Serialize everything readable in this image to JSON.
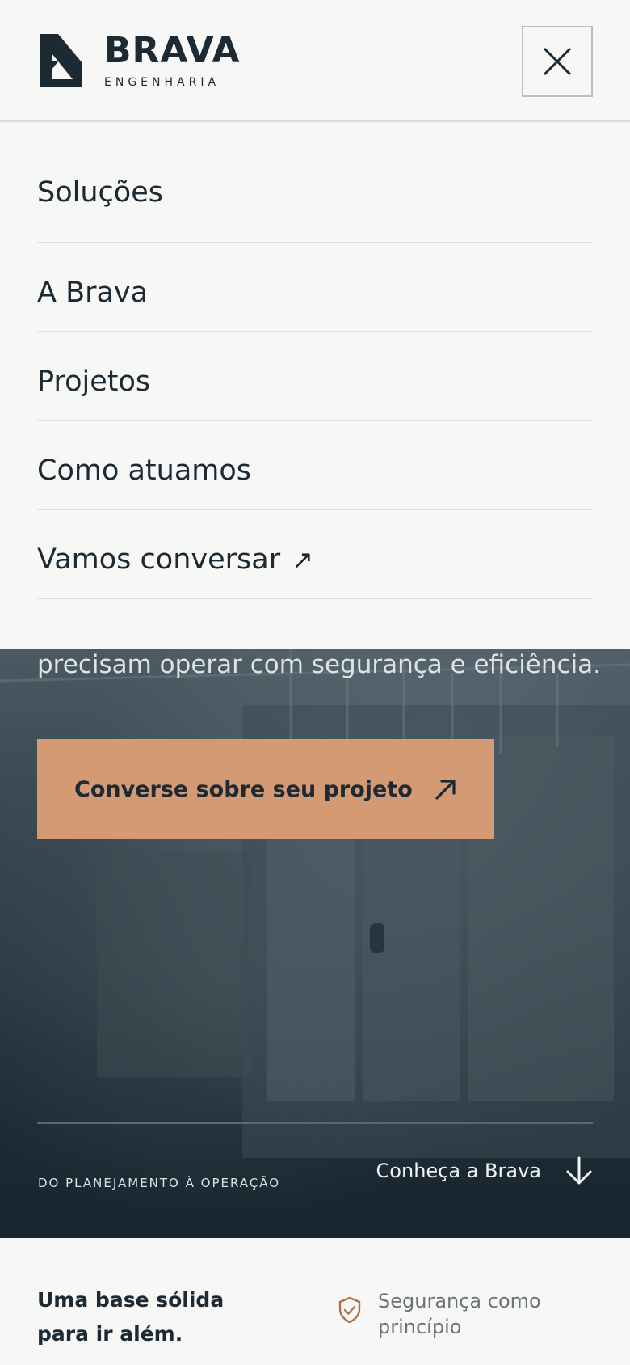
{
  "brand": {
    "name": "BRAVA",
    "tagline": "ENGENHARIA",
    "colors": {
      "ink": "#1c2a33",
      "accent": "#d39a73",
      "background": "#f7f7f5"
    }
  },
  "header": {
    "close_icon": "close-icon"
  },
  "menu": {
    "items": [
      {
        "label": "Soluções"
      },
      {
        "label": "A Brava"
      },
      {
        "label": "Projetos"
      },
      {
        "label": "Como atuamos"
      },
      {
        "label": "Vamos conversar",
        "arrow": "↗"
      }
    ]
  },
  "hero": {
    "text": "precisam operar com segurança e eficiência.",
    "cta_label": "Converse sobre seu projeto",
    "cta_icon": "arrow-up-right-icon",
    "tag": "DO PLANEJAMENTO À OPERAÇÃO",
    "scroll_label": "Conheça a Brava",
    "scroll_icon": "arrow-down-icon"
  },
  "strip": {
    "heading_line1": "Uma base sólida",
    "heading_line2": "para ir além.",
    "feature_line1": "Segurança como",
    "feature_line2": "princípio",
    "feature_icon": "shield-check-icon"
  }
}
